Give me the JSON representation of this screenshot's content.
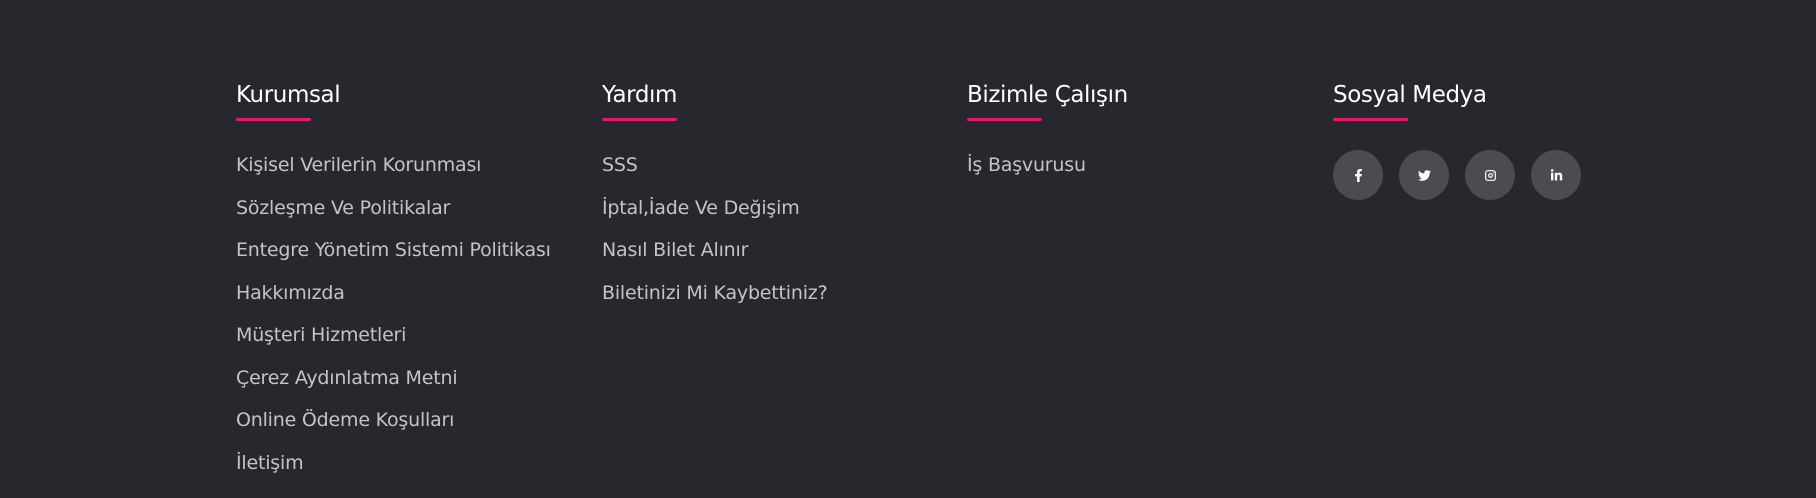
{
  "columns": {
    "kurumsal": {
      "title": "Kurumsal",
      "links": [
        "Kişisel Verilerin Korunması",
        "Sözleşme Ve Politikalar",
        "Entegre Yönetim Sistemi Politikası",
        "Hakkımızda",
        "Müşteri Hizmetleri",
        "Çerez Aydınlatma Metni",
        "Online Ödeme Koşulları",
        "İletişim"
      ]
    },
    "yardim": {
      "title": "Yardım",
      "links": [
        "SSS",
        "İptal,İade Ve Değişim",
        "Nasıl Bilet Alınır",
        "Biletinizi Mi Kaybettiniz?"
      ]
    },
    "kariyer": {
      "title": "Bizimle Çalışın",
      "links": [
        "İş Başvurusu"
      ]
    },
    "sosyal": {
      "title": "Sosyal Medya",
      "icons": [
        "facebook-icon",
        "twitter-icon",
        "instagram-icon",
        "linkedin-icon"
      ]
    }
  },
  "colors": {
    "background": "#27282d",
    "accent": "#e4196b",
    "link": "#c3c4c9",
    "social_button": "#4b4c52"
  }
}
